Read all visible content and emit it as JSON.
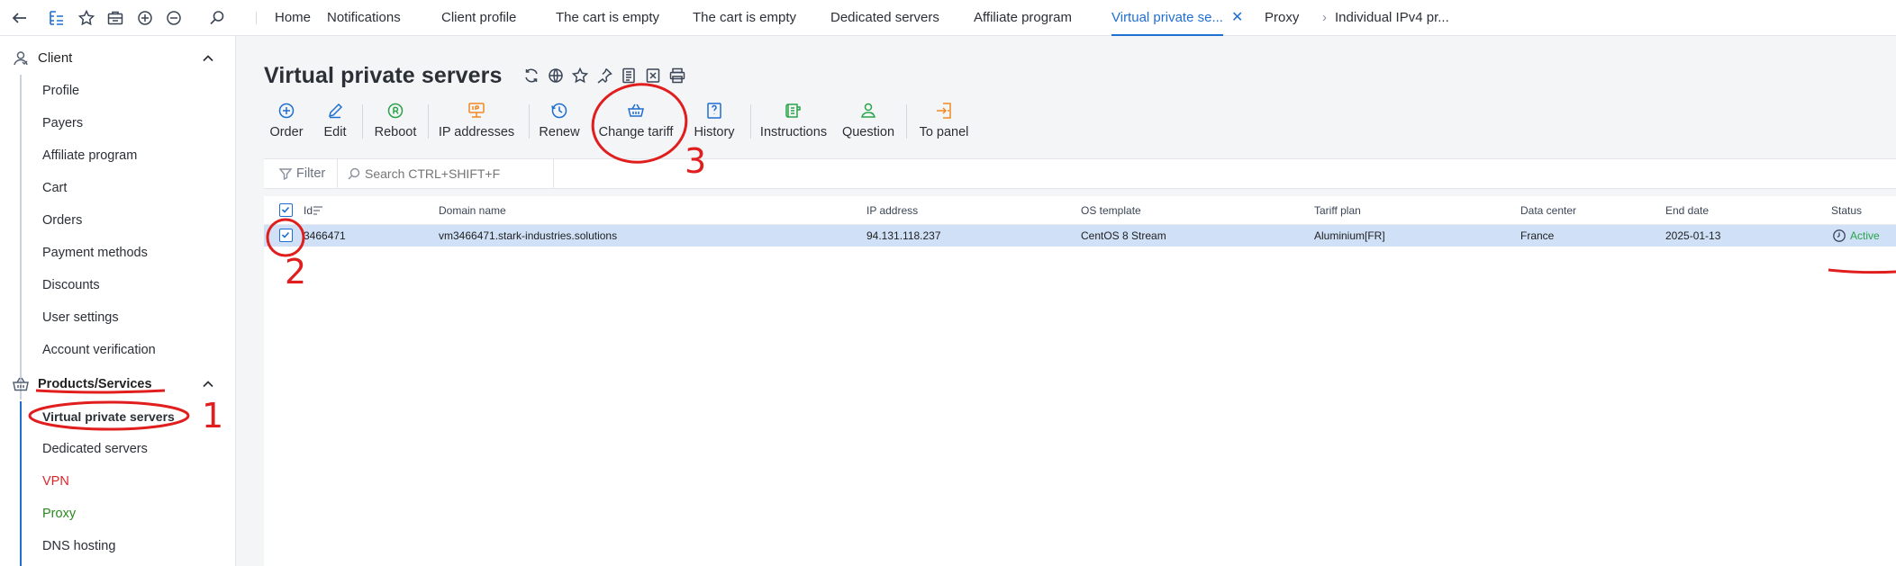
{
  "topbar": {
    "tabs": [
      {
        "label": "Home"
      },
      {
        "label": "Notifications"
      },
      {
        "label": "Client profile"
      },
      {
        "label": "The cart is empty"
      },
      {
        "label": "The cart is empty"
      },
      {
        "label": "Dedicated servers"
      },
      {
        "label": "Affiliate program"
      },
      {
        "label": "Virtual private se..."
      },
      {
        "label": "Proxy"
      },
      {
        "label": "Individual IPv4 pr..."
      }
    ],
    "active_tab_index": 7,
    "close_glyph": "✕",
    "overflow_glyph": "›"
  },
  "sidebar": {
    "client": {
      "label": "Client",
      "items": [
        "Profile",
        "Payers",
        "Affiliate program",
        "Cart",
        "Orders",
        "Payment methods",
        "Discounts",
        "User settings",
        "Account verification"
      ]
    },
    "products": {
      "label": "Products/Services",
      "items": [
        {
          "label": "Virtual private servers",
          "color": "#222222"
        },
        {
          "label": "Dedicated servers",
          "color": "#2b2f36"
        },
        {
          "label": "VPN",
          "color": "#d9262c"
        },
        {
          "label": "Proxy",
          "color": "#2a8a1f"
        },
        {
          "label": "DNS hosting",
          "color": "#2b2f36"
        }
      ]
    }
  },
  "page": {
    "title": "Virtual private servers"
  },
  "toolbar": {
    "buttons": [
      {
        "label": "Order",
        "icon": "plus-circle-icon",
        "color": "#1f6fd1"
      },
      {
        "label": "Edit",
        "icon": "pencil-icon",
        "color": "#1f6fd1"
      },
      {
        "label": "Reboot",
        "icon": "reboot-icon",
        "color": "#2aa34a"
      },
      {
        "label": "IP addresses",
        "icon": "ip-address-icon",
        "color": "#f08a24"
      },
      {
        "label": "Renew",
        "icon": "clock-renew-icon",
        "color": "#1f6fd1"
      },
      {
        "label": "Change tariff",
        "icon": "basket-icon",
        "color": "#1f6fd1"
      },
      {
        "label": "History",
        "icon": "history-icon",
        "color": "#1f6fd1"
      },
      {
        "label": "Instructions",
        "icon": "instructions-icon",
        "color": "#2aa34a"
      },
      {
        "label": "Question",
        "icon": "question-user-icon",
        "color": "#2aa34a"
      },
      {
        "label": "To panel",
        "icon": "to-panel-icon",
        "color": "#f08a24"
      }
    ]
  },
  "filter": {
    "label": "Filter",
    "search_placeholder": "Search CTRL+SHIFT+F"
  },
  "table": {
    "columns": [
      "Id",
      "Domain name",
      "IP address",
      "OS template",
      "Tariff plan",
      "Data center",
      "End date",
      "Status"
    ],
    "rows": [
      {
        "id": "3466471",
        "domain": "vm3466471.stark-industries.solutions",
        "ip": "94.131.118.237",
        "os": "CentOS 8 Stream",
        "tariff": "Aluminium[FR]",
        "datacenter": "France",
        "end_date": "2025-01-13",
        "status": "Active"
      }
    ]
  },
  "annotations": {
    "marks": [
      "1",
      "2",
      "3"
    ],
    "color": "#e01e1e"
  }
}
